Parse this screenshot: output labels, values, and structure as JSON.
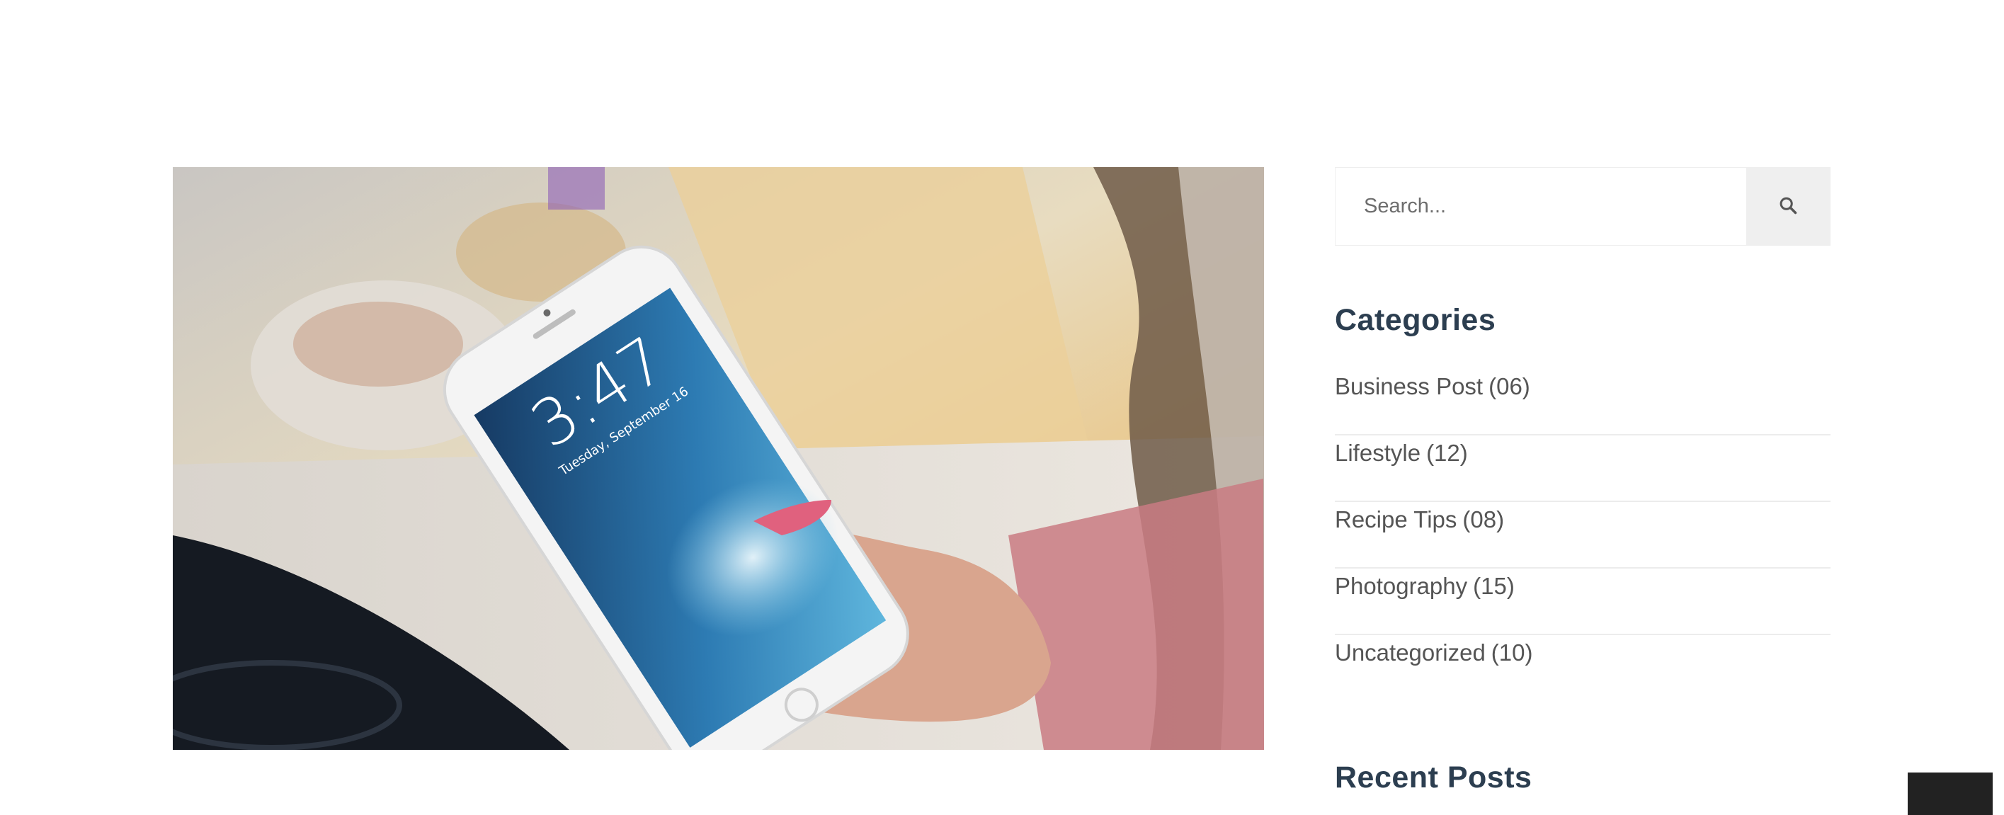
{
  "hero": {
    "alt_description": ""
  },
  "search": {
    "placeholder": "Search...",
    "icon": "search-icon"
  },
  "categories": {
    "title": "Categories",
    "items": [
      {
        "name": "Business Post",
        "count": "(06)"
      },
      {
        "name": "Lifestyle",
        "count": "(12)"
      },
      {
        "name": "Recipe Tips",
        "count": "(08)"
      },
      {
        "name": "Photography",
        "count": "(15)"
      },
      {
        "name": "Uncategorized",
        "count": "(10)"
      }
    ]
  },
  "recent_posts": {
    "title": "Recent Posts"
  },
  "colors": {
    "heading": "#2c3e50",
    "text": "#555555",
    "divider": "#ececec",
    "search_button_bg": "#efefef"
  },
  "phone_screen": {
    "time": "3:47",
    "date": "Tuesday, September 16"
  }
}
